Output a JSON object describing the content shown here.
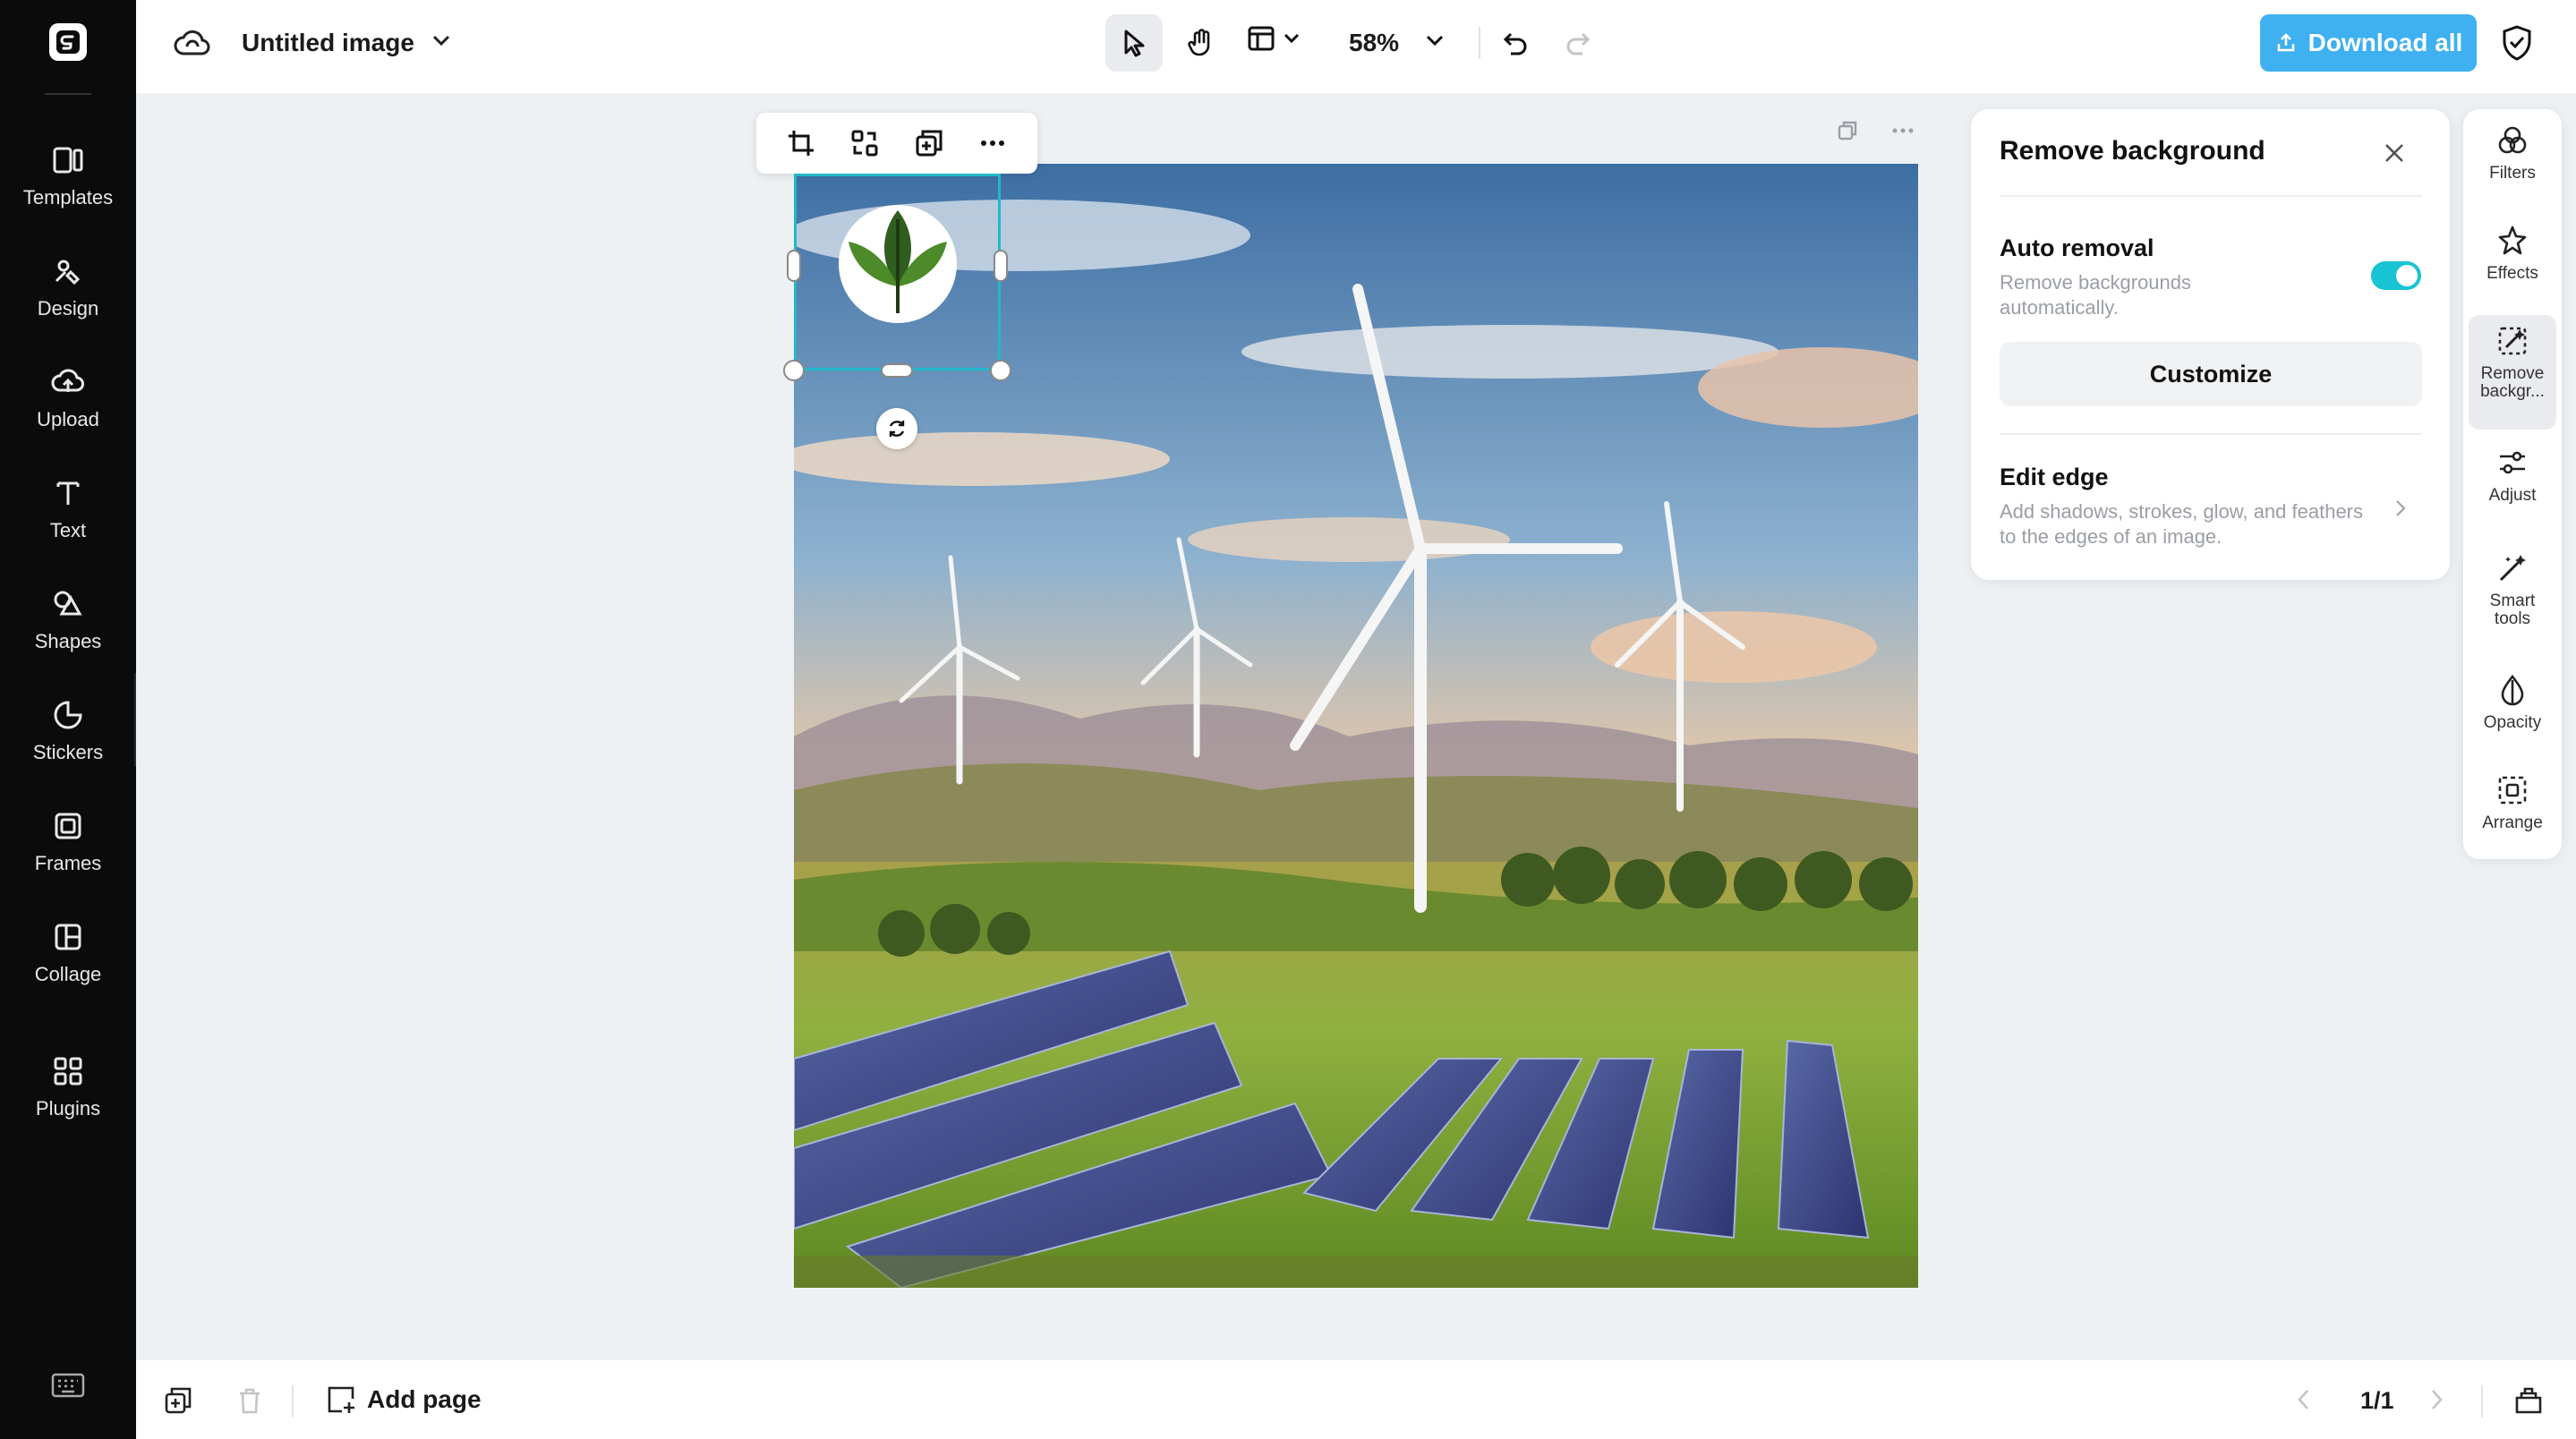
{
  "app": {
    "document_title": "Untitled image",
    "accent_color": "#3fb0f0",
    "toggle_color": "#18c3d3",
    "selection_color": "#22b8c8"
  },
  "sidebar": {
    "items": [
      {
        "label": "Templates",
        "icon": "templates-icon"
      },
      {
        "label": "Design",
        "icon": "design-icon"
      },
      {
        "label": "Upload",
        "icon": "upload-icon"
      },
      {
        "label": "Text",
        "icon": "text-icon"
      },
      {
        "label": "Shapes",
        "icon": "shapes-icon"
      },
      {
        "label": "Stickers",
        "icon": "stickers-icon"
      },
      {
        "label": "Frames",
        "icon": "frames-icon"
      },
      {
        "label": "Collage",
        "icon": "collage-icon"
      },
      {
        "label": "Plugins",
        "icon": "plugins-icon"
      }
    ]
  },
  "topbar": {
    "zoom": "58%",
    "download_label": "Download all",
    "active_tool": "select"
  },
  "panel": {
    "title": "Remove background",
    "auto_removal": {
      "title": "Auto removal",
      "description": "Remove backgrounds automatically.",
      "enabled": true
    },
    "customize_label": "Customize",
    "edit_edge": {
      "title": "Edit edge",
      "description": "Add shadows, strokes, glow, and feathers to the edges of an image."
    }
  },
  "tool_rail": {
    "items": [
      {
        "label": "Filters",
        "icon": "filters-icon"
      },
      {
        "label": "Effects",
        "icon": "effects-icon"
      },
      {
        "label": "Remove backgr...",
        "icon": "remove-background-icon",
        "active": true
      },
      {
        "label": "Adjust",
        "icon": "adjust-icon"
      },
      {
        "label": "Smart tools",
        "icon": "smart-tools-icon"
      },
      {
        "label": "Opacity",
        "icon": "opacity-icon"
      },
      {
        "label": "Arrange",
        "icon": "arrange-icon"
      }
    ]
  },
  "bottombar": {
    "add_page_label": "Add page",
    "page_indicator": "1/1"
  }
}
